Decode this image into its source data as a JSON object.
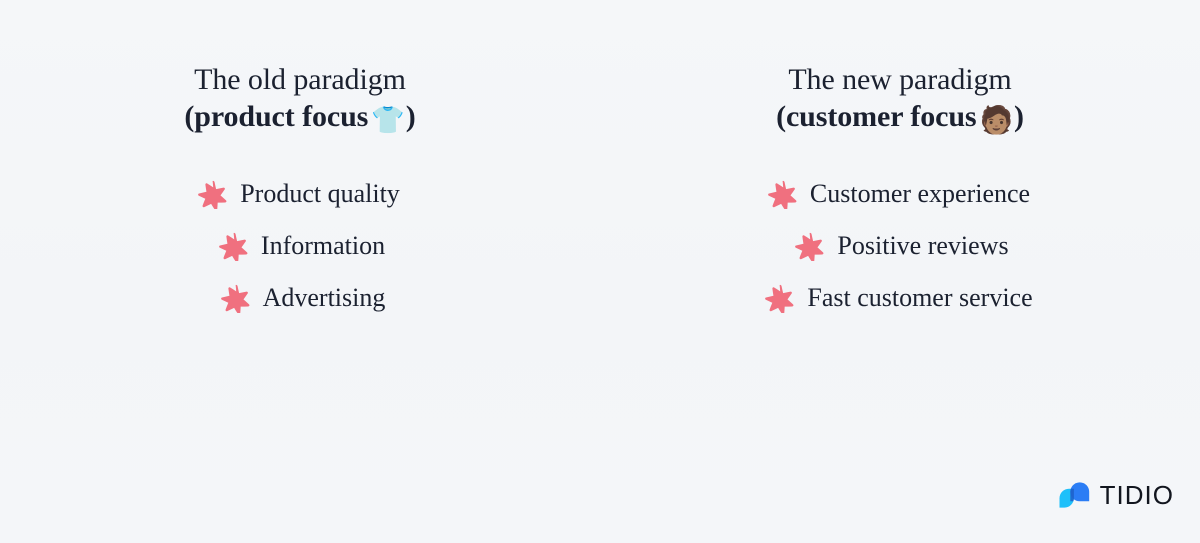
{
  "canvas": {
    "background_color": "#f4f6f9",
    "text_color": "#1b2130"
  },
  "columns": [
    {
      "id": "old-paradigm",
      "heading_line1": "The old paradigm",
      "heading_open_paren": "(",
      "heading_line2": "product focus",
      "heading_emoji": "👕",
      "heading_emoji_name": "t-shirt-emoji",
      "heading_close_paren": ")",
      "bullet_color": "#f0707f",
      "items": [
        {
          "label": "Product quality",
          "bullet": "star"
        },
        {
          "label": "Information",
          "bullet": "star"
        },
        {
          "label": "Advertising",
          "bullet": "star"
        }
      ]
    },
    {
      "id": "new-paradigm",
      "heading_line1": "The new paradigm",
      "heading_open_paren": "(",
      "heading_line2": "customer focus",
      "heading_emoji": "🧑🏽",
      "heading_emoji_name": "person-emoji",
      "heading_close_paren": ")",
      "bullet_color": "#f0707f",
      "items": [
        {
          "label": "Customer experience",
          "bullet": "star"
        },
        {
          "label": "Positive reviews",
          "bullet": "star"
        },
        {
          "label": "Fast customer service",
          "bullet": "star"
        }
      ]
    }
  ],
  "brand": {
    "name": "TIDIO",
    "mark_color_primary": "#2b7df5",
    "mark_color_secondary": "#1ec0fa",
    "wordmark_color": "#12161f"
  }
}
